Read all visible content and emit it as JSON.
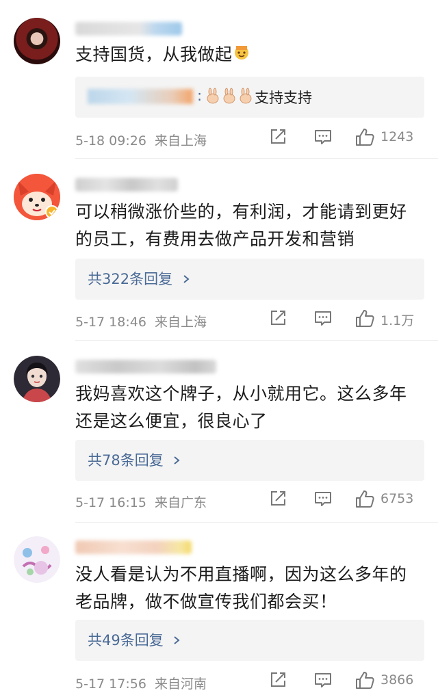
{
  "comments": [
    {
      "text": "支持国货，从我做起",
      "reply_preview": "支持支持",
      "time": "5-18 09:26",
      "location": "来自上海",
      "likes": "1243"
    },
    {
      "text_line1": "可以稍微涨价些的，有利润，才能请到更好",
      "text_line2": "的员工，有费用去做产品开发和营销",
      "replies": "共322条回复",
      "time": "5-17 18:46",
      "location": "来自上海",
      "likes": "1.1万"
    },
    {
      "text_line1": "我妈喜欢这个牌子，从小就用它。这么多年",
      "text_line2": "还是这么便宜，很良心了",
      "replies": "共78条回复",
      "time": "5-17 16:15",
      "location": "来自广东",
      "likes": "6753"
    },
    {
      "text_line1": "没人看是认为不用直播啊，因为这么多年的",
      "text_line2": "老品牌，做不做宣传我们都会买！",
      "replies": "共49条回复",
      "time": "5-17 17:56",
      "location": "来自河南",
      "likes": "3866"
    }
  ],
  "icons": {
    "share": "share-icon",
    "comment": "comment-icon",
    "like": "thumbs-up-icon",
    "chevron": "chevron-right-icon"
  },
  "colors": {
    "link": "#4a6a96",
    "meta": "#8a8a8a",
    "reply_bg": "#f4f4f4"
  }
}
